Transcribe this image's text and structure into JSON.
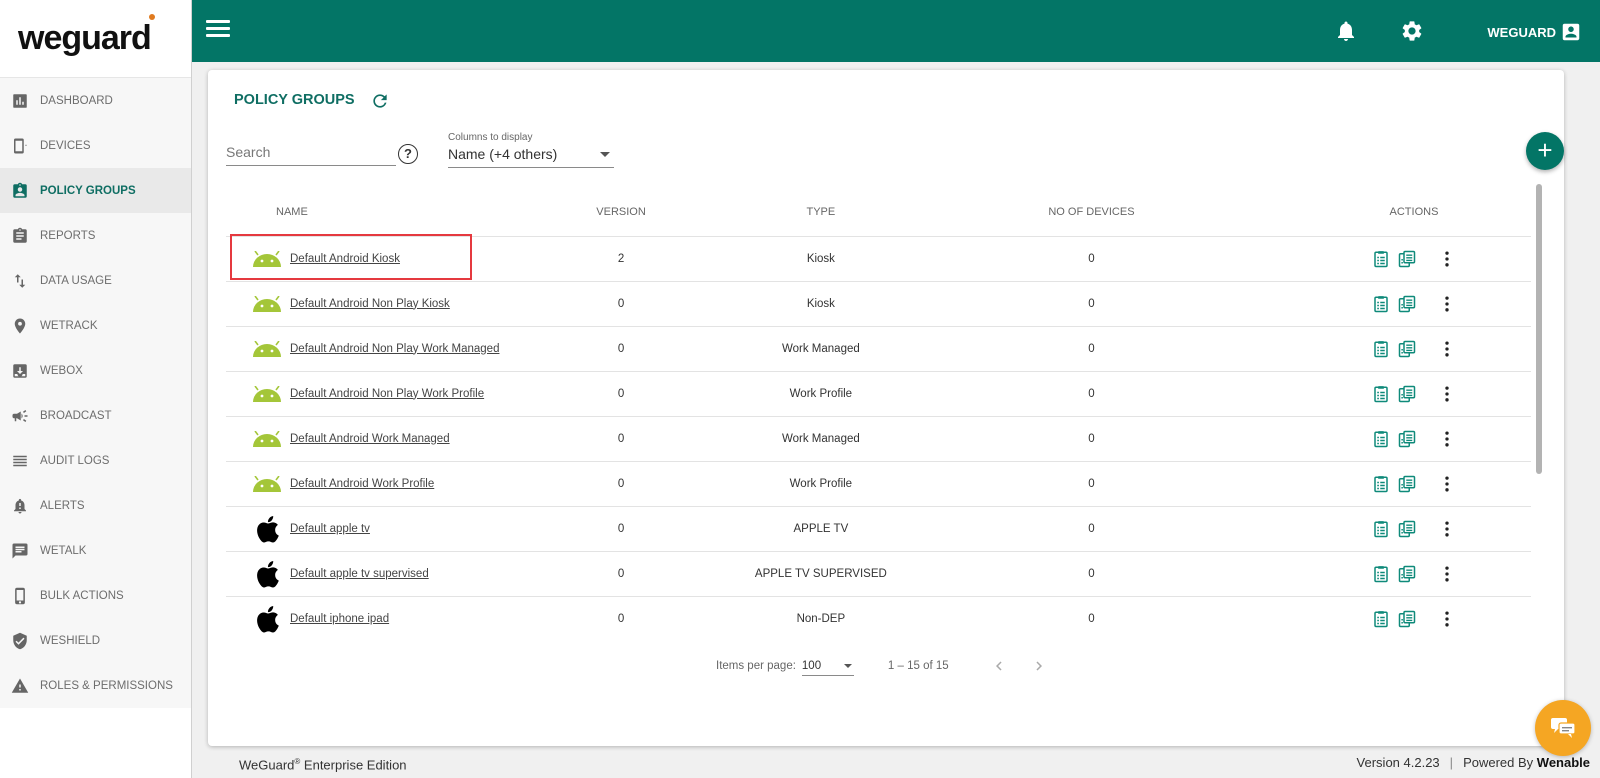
{
  "brand": {
    "logo_text": "weguard"
  },
  "sidebar": {
    "items": [
      {
        "label": "DASHBOARD",
        "icon": "chart-icon",
        "active": false
      },
      {
        "label": "DEVICES",
        "icon": "device-icon",
        "active": false
      },
      {
        "label": "POLICY GROUPS",
        "icon": "policy-icon",
        "active": true
      },
      {
        "label": "REPORTS",
        "icon": "clipboard-icon",
        "active": false
      },
      {
        "label": "DATA USAGE",
        "icon": "arrows-icon",
        "active": false
      },
      {
        "label": "WETRACK",
        "icon": "pin-icon",
        "active": false
      },
      {
        "label": "WEBOX",
        "icon": "inbox-icon",
        "active": false
      },
      {
        "label": "BROADCAST",
        "icon": "megaphone-icon",
        "active": false
      },
      {
        "label": "AUDIT LOGS",
        "icon": "list-icon",
        "active": false
      },
      {
        "label": "ALERTS",
        "icon": "bell-alert-icon",
        "active": false
      },
      {
        "label": "WETALK",
        "icon": "chat-icon",
        "active": false
      },
      {
        "label": "BULK ACTIONS",
        "icon": "phone-icon",
        "active": false
      },
      {
        "label": "WESHIELD",
        "icon": "shield-icon",
        "active": false
      },
      {
        "label": "ROLES & PERMISSIONS",
        "icon": "warning-icon",
        "active": false
      }
    ]
  },
  "topbar": {
    "user_label": "WEGUARD"
  },
  "page": {
    "title": "POLICY GROUPS",
    "search_placeholder": "Search",
    "help_label": "?",
    "columns_label": "Columns to display",
    "columns_value": "Name (+4 others)",
    "add_label": "+"
  },
  "table": {
    "headers": {
      "name": "NAME",
      "version": "VERSION",
      "type": "TYPE",
      "devices": "NO OF DEVICES",
      "actions": "ACTIONS"
    },
    "rows": [
      {
        "name": "Default Android Kiosk",
        "os": "android",
        "version": "2",
        "type": "Kiosk",
        "devices": "0",
        "highlighted": true
      },
      {
        "name": "Default Android Non Play Kiosk",
        "os": "android",
        "version": "0",
        "type": "Kiosk",
        "devices": "0"
      },
      {
        "name": "Default Android Non Play Work Managed",
        "os": "android",
        "version": "0",
        "type": "Work Managed",
        "devices": "0"
      },
      {
        "name": "Default Android Non Play Work Profile",
        "os": "android",
        "version": "0",
        "type": "Work Profile",
        "devices": "0"
      },
      {
        "name": "Default Android Work Managed",
        "os": "android",
        "version": "0",
        "type": "Work Managed",
        "devices": "0"
      },
      {
        "name": "Default Android Work Profile",
        "os": "android",
        "version": "0",
        "type": "Work Profile",
        "devices": "0"
      },
      {
        "name": "Default apple tv",
        "os": "apple",
        "version": "0",
        "type": "APPLE TV",
        "devices": "0"
      },
      {
        "name": "Default apple tv supervised",
        "os": "apple",
        "version": "0",
        "type": "APPLE TV SUPERVISED",
        "devices": "0"
      },
      {
        "name": "Default iphone ipad",
        "os": "apple",
        "version": "0",
        "type": "Non-DEP",
        "devices": "0"
      }
    ]
  },
  "pagination": {
    "items_per_page_label": "Items per page:",
    "items_per_page": "100",
    "range": "1 – 15 of 15"
  },
  "footer": {
    "edition_brand": "WeGuard",
    "edition_reg": "®",
    "edition_text": " Enterprise Edition",
    "version": "Version 4.2.23",
    "powered_by": "Powered By",
    "powered_brand": "Wenable"
  },
  "colors": {
    "primary": "#037566",
    "accent": "#0f6e63",
    "android": "#a4c639",
    "chat": "#f5a623",
    "highlight": "#e5393f"
  }
}
